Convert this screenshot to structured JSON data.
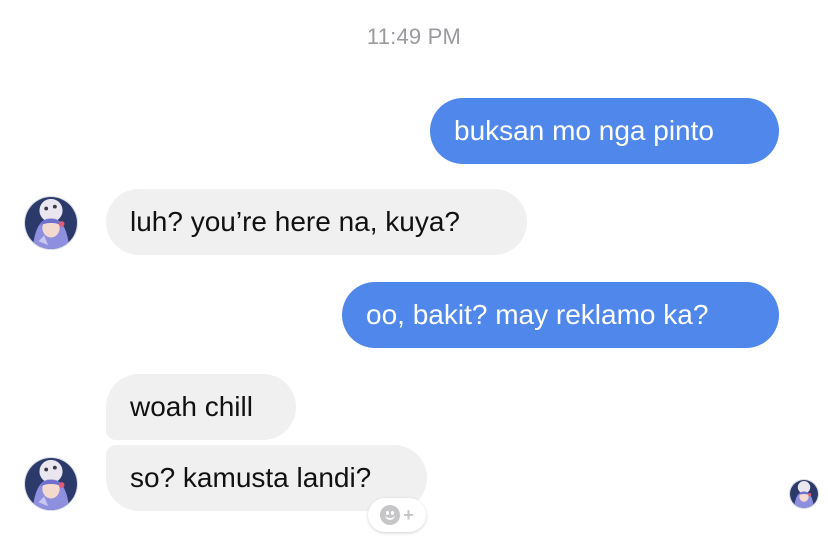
{
  "conversation": {
    "timestamp": "11:49 PM",
    "messages": [
      {
        "direction": "outgoing",
        "text": "buksan mo nga pinto"
      },
      {
        "direction": "incoming",
        "text": "luh? you’re here na, kuya?"
      },
      {
        "direction": "outgoing",
        "text": "oo, bakit? may reklamo ka?"
      },
      {
        "direction": "incoming",
        "text": "woah chill"
      },
      {
        "direction": "incoming",
        "text": "so? kamusta landi?"
      }
    ],
    "reaction_button": {
      "icon": "add-reaction-icon",
      "glyph": "+"
    },
    "seen_indicator": {
      "icon": "read-receipt-avatar"
    }
  },
  "colors": {
    "outgoing_bubble": "#4f87eb",
    "incoming_bubble": "#f0f0f0",
    "timestamp_text": "#9a9a9f"
  }
}
